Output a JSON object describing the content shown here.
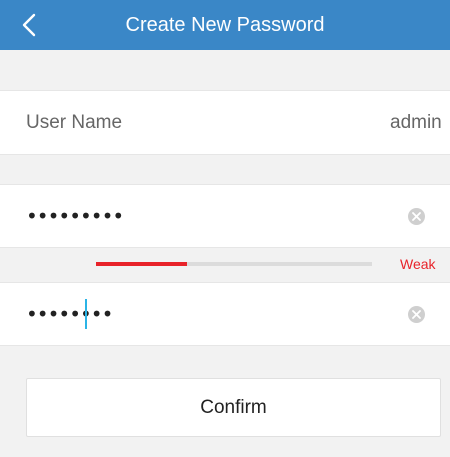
{
  "header": {
    "title": "Create New Password",
    "back_icon": "chevron-left-icon",
    "background_color": "#3a87c7"
  },
  "user": {
    "label": "User Name",
    "value": "admin"
  },
  "new_password": {
    "value": "•••••••••",
    "clear_icon": "clear-circle-icon"
  },
  "strength": {
    "label": "Weak",
    "fraction": 0.33,
    "color": "#e8232a"
  },
  "confirm_password": {
    "value": "••••••••",
    "clear_icon": "clear-circle-icon"
  },
  "confirm_button": {
    "label": "Confirm"
  }
}
